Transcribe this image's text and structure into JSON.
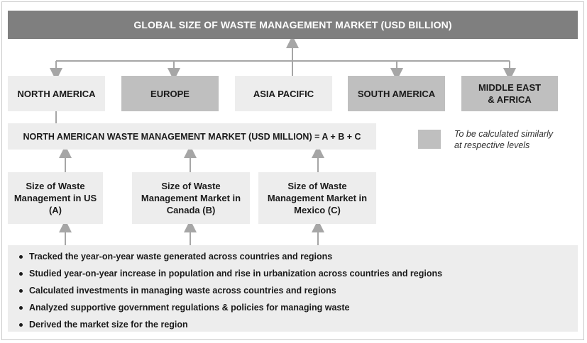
{
  "title": "GLOBAL SIZE OF WASTE MANAGEMENT MARKET (USD BILLION)",
  "regions": [
    {
      "line1": "NORTH AMERICA",
      "line2": "",
      "shade": "light"
    },
    {
      "line1": "EUROPE",
      "line2": "",
      "shade": "dark"
    },
    {
      "line1": "ASIA PACIFIC",
      "line2": "",
      "shade": "light"
    },
    {
      "line1": "SOUTH AMERICA",
      "line2": "",
      "shade": "dark"
    },
    {
      "line1": "MIDDLE EAST",
      "line2": "& AFRICA",
      "shade": "dark"
    }
  ],
  "formula": "NORTH AMERICAN WASTE MANAGEMENT MARKET (USD MILLION) = A + B + C",
  "legend": {
    "line1": "To be calculated similarly",
    "line2": "at respective levels"
  },
  "countries": [
    {
      "line1": "Size of Waste",
      "line2": "Management in US (A)",
      "line3": ""
    },
    {
      "line1": "Size of Waste",
      "line2": "Management Market in",
      "line3": "Canada (B)"
    },
    {
      "line1": "Size of Waste",
      "line2": "Management Market in",
      "line3": "Mexico (C)"
    }
  ],
  "bullets": [
    "Tracked the year-on-year waste generated across countries and regions",
    "Studied year-on-year increase in population and rise in urbanization across countries and regions",
    "Calculated investments in managing waste across countries and regions",
    "Analyzed supportive government regulations & policies for managing waste",
    "Derived the market size for the region"
  ],
  "colors": {
    "title_bar": "#7f7f7f",
    "light_box": "#ededed",
    "dark_box": "#bfbfbf",
    "arrow": "#a6a6a6"
  }
}
